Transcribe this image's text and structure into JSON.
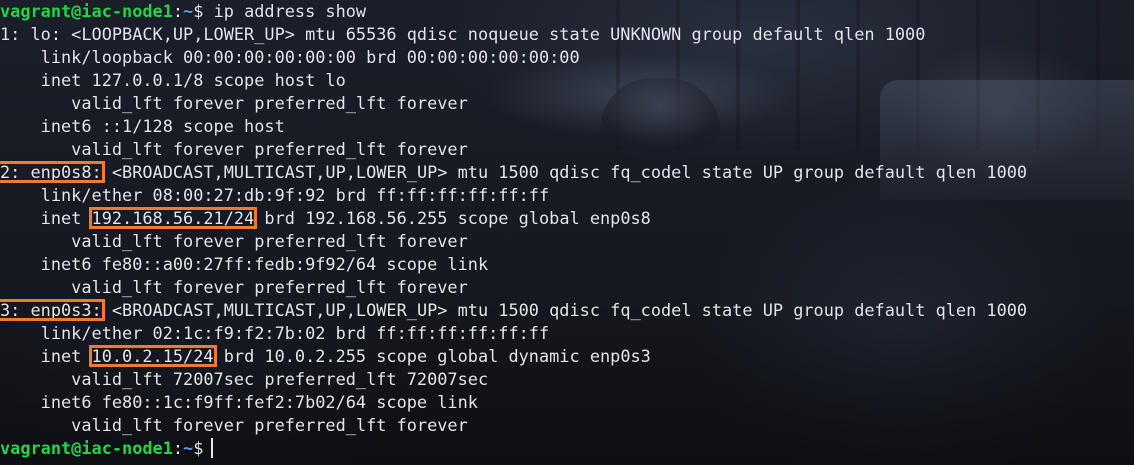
{
  "prompt": {
    "user_host": "vagrant@iac-node1",
    "colon": ":",
    "path": "~",
    "dollar": "$"
  },
  "command": "ip address show",
  "output": {
    "l01": "1: lo: <LOOPBACK,UP,LOWER_UP> mtu 65536 qdisc noqueue state UNKNOWN group default qlen 1000",
    "l02": "    link/loopback 00:00:00:00:00:00 brd 00:00:00:00:00:00",
    "l03": "    inet 127.0.0.1/8 scope host lo",
    "l04": "       valid_lft forever preferred_lft forever",
    "l05": "    inet6 ::1/128 scope host",
    "l06": "       valid_lft forever preferred_lft forever",
    "l07_iface": "2: enp0s8:",
    "l07_rest": " <BROADCAST,MULTICAST,UP,LOWER_UP> mtu 1500 qdisc fq_codel state UP group default qlen 1000",
    "l08": "    link/ether 08:00:27:db:9f:92 brd ff:ff:ff:ff:ff:ff",
    "l09_pre": "    inet ",
    "l09_addr": "192.168.56.21/24",
    "l09_rest": " brd 192.168.56.255 scope global enp0s8",
    "l10": "       valid_lft forever preferred_lft forever",
    "l11": "    inet6 fe80::a00:27ff:fedb:9f92/64 scope link",
    "l12": "       valid_lft forever preferred_lft forever",
    "l13_iface": "3: enp0s3:",
    "l13_rest": " <BROADCAST,MULTICAST,UP,LOWER_UP> mtu 1500 qdisc fq_codel state UP group default qlen 1000",
    "l14": "    link/ether 02:1c:f9:f2:7b:02 brd ff:ff:ff:ff:ff:ff",
    "l15_pre": "    inet ",
    "l15_addr": "10.0.2.15/24",
    "l15_rest": " brd 10.0.2.255 scope global dynamic enp0s3",
    "l16": "       valid_lft 72007sec preferred_lft 72007sec",
    "l17": "    inet6 fe80::1c:f9ff:fef2:7b02/64 scope link",
    "l18": "       valid_lft forever preferred_lft forever"
  },
  "highlight_color": "#f37a2d"
}
